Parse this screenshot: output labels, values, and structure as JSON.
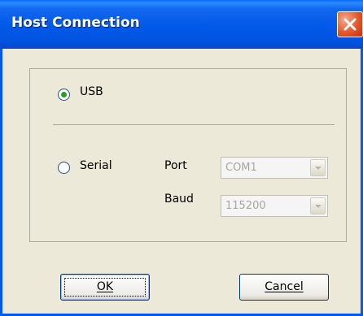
{
  "window": {
    "title": "Host Connection"
  },
  "titlebar": {
    "close_icon": "close-icon"
  },
  "connection": {
    "usb": {
      "label": "USB",
      "selected": true
    },
    "serial": {
      "label": "Serial",
      "selected": false,
      "port_label": "Port",
      "port_value": "COM1",
      "baud_label": "Baud",
      "baud_value": "115200"
    }
  },
  "buttons": {
    "ok": "OK",
    "cancel": "Cancel"
  },
  "colors": {
    "titlebar": "#0258e8",
    "radio_dot": "#21a121",
    "close_button": "#e4572a"
  }
}
